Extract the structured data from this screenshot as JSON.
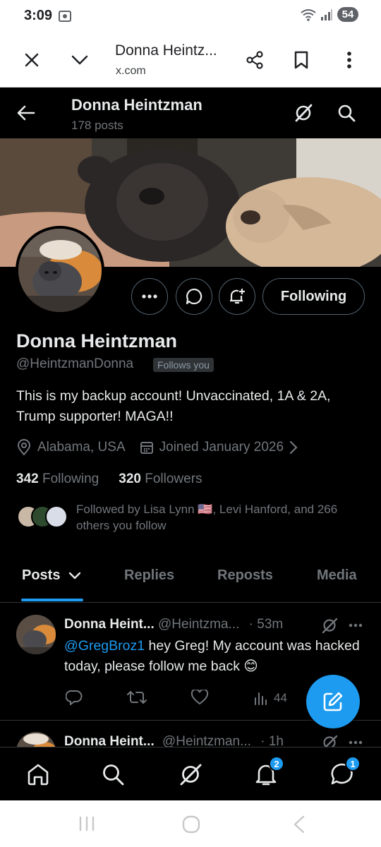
{
  "status_bar": {
    "time": "3:09",
    "battery": "54"
  },
  "browser": {
    "title": "Donna Heintz...",
    "url": "x.com"
  },
  "header": {
    "name": "Donna Heintzman",
    "posts_count": "178 posts"
  },
  "profile": {
    "name": "Donna Heintzman",
    "handle": "@HeintzmanDonna",
    "follows_you": "Follows you",
    "bio": "This is my backup account! Unvaccinated, 1A & 2A, Trump supporter! MAGA!!",
    "location": "Alabama, USA",
    "joined": "Joined January 2026",
    "following_count": "342",
    "following_label": "Following",
    "followers_count": "320",
    "followers_label": "Followers",
    "followed_by": "Followed by Lisa Lynn 🇺🇸, Levi Hanford, and 266 others you follow",
    "following_button": "Following"
  },
  "tabs": [
    {
      "label": "Posts"
    },
    {
      "label": "Replies"
    },
    {
      "label": "Reposts"
    },
    {
      "label": "Media"
    }
  ],
  "posts": [
    {
      "name": "Donna Heint...",
      "handle": "@Heintzma...",
      "time": "· 53m",
      "mention": "@GregBroz1",
      "text": " hey Greg! My account was hacked today, please follow me back 😊",
      "views": "44"
    },
    {
      "name": "Donna Heint...",
      "handle": "@Heintzman...",
      "time": "· 1h"
    }
  ],
  "nav_badges": {
    "notifications": "2",
    "messages": "1"
  },
  "colors": {
    "accent": "#1d9bf0",
    "background": "#000000",
    "secondary_text": "#71767b"
  }
}
